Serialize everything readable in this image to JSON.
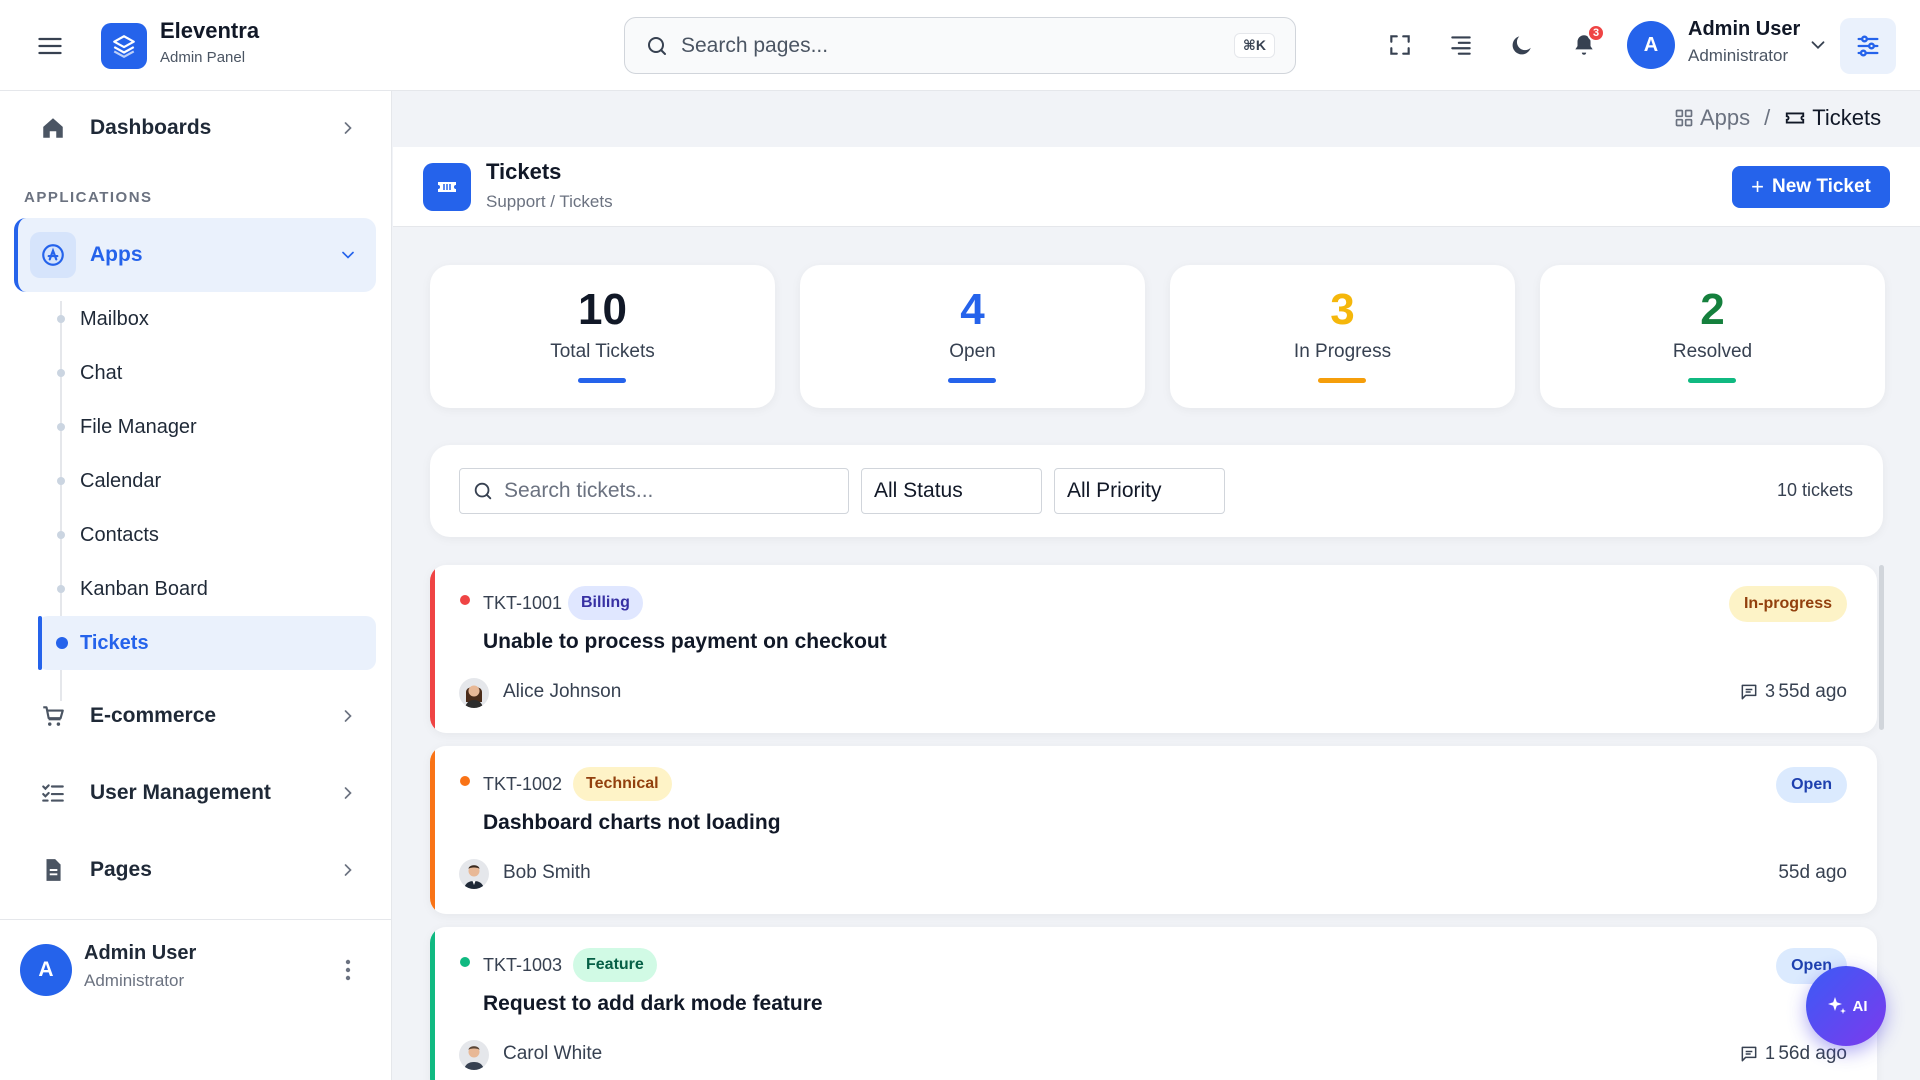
{
  "brand": {
    "name": "Eleventra",
    "subtitle": "Admin Panel"
  },
  "search": {
    "placeholder": "Search pages...",
    "shortcut": "⌘K"
  },
  "header": {
    "notification_count": "3"
  },
  "user": {
    "initial": "A",
    "name": "Admin User",
    "role": "Administrator"
  },
  "sidebar": {
    "dashboards": "Dashboards",
    "section_label": "APPLICATIONS",
    "apps": "Apps",
    "apps_sub": [
      "Mailbox",
      "Chat",
      "File Manager",
      "Calendar",
      "Contacts",
      "Kanban Board",
      "Tickets"
    ],
    "ecommerce": "E-commerce",
    "user_management": "User Management",
    "pages": "Pages"
  },
  "breadcrumb": {
    "parent": "Apps",
    "separator": "/",
    "current": "Tickets"
  },
  "page": {
    "title": "Tickets",
    "subtitle": "Support / Tickets",
    "new_button": "New Ticket"
  },
  "stats": [
    {
      "value": "10",
      "label": "Total Tickets",
      "color": "#111827",
      "bar": "#2563eb"
    },
    {
      "value": "4",
      "label": "Open",
      "color": "#2563eb",
      "bar": "#2563eb"
    },
    {
      "value": "3",
      "label": "In Progress",
      "color": "#f5b70b",
      "bar": "#f59e0b"
    },
    {
      "value": "2",
      "label": "Resolved",
      "color": "#15803d",
      "bar": "#10b981"
    }
  ],
  "filters": {
    "search_placeholder": "Search tickets...",
    "status": "All Status",
    "priority": "All Priority",
    "count": "10 tickets"
  },
  "tickets": [
    {
      "id": "TKT-1001",
      "category": "Billing",
      "status": "In-progress",
      "title": "Unable to process payment on checkout",
      "author": "Alice Johnson",
      "comments": "3",
      "time": "55d ago",
      "priority_color": "#ef4444"
    },
    {
      "id": "TKT-1002",
      "category": "Technical",
      "status": "Open",
      "title": "Dashboard charts not loading",
      "author": "Bob Smith",
      "comments": "",
      "time": "55d ago",
      "priority_color": "#f97316"
    },
    {
      "id": "TKT-1003",
      "category": "Feature",
      "status": "Open",
      "title": "Request to add dark mode feature",
      "author": "Carol White",
      "comments": "1",
      "time": "56d ago",
      "priority_color": "#10b981"
    }
  ],
  "ai": {
    "label": "AI"
  }
}
